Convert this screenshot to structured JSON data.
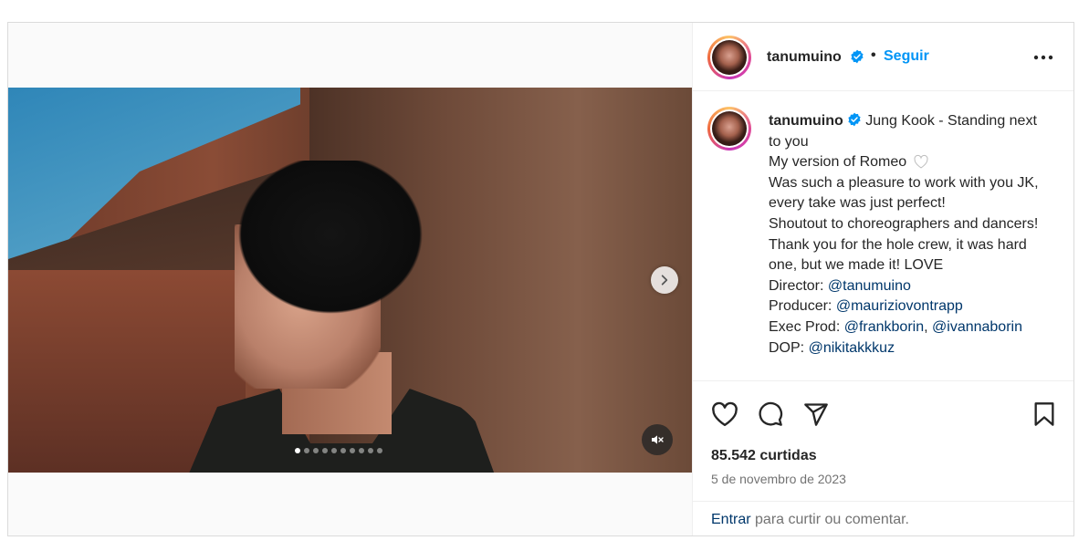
{
  "post": {
    "username": "tanumuino",
    "follow_label": "Seguir",
    "separator": "•",
    "carousel": {
      "slide_count": 10,
      "active_index": 0
    }
  },
  "caption": {
    "username": "tanumuino",
    "line1": "Jung Kook - Standing next to you",
    "line2": "My version of Romeo",
    "line3": "Was such a pleasure to work with you JK, every take was just perfect!",
    "line4": "Shoutout to choreographers and dancers!",
    "line5": "Thank you for the hole crew, it was hard one, but we made it! LOVE",
    "director_label": "Director:",
    "director": "@tanumuino",
    "producer_label": "Producer:",
    "producer": "@mauriziovontrapp",
    "exec_label": "Exec Prod:",
    "exec1": "@frankborin",
    "exec_sep": ",",
    "exec2": "@ivannaborin",
    "dop_label": "DOP:",
    "dop": "@nikitakkkuz"
  },
  "stats": {
    "likes": "85.542 curtidas",
    "date": "5 de novembro de 2023"
  },
  "comment_bar": {
    "login_link": "Entrar",
    "text": "para curtir ou comentar."
  },
  "colors": {
    "link": "#0095f6",
    "mention": "#00376b",
    "verified": "#0095f6"
  },
  "icons": [
    "verified-icon",
    "more-icon",
    "chevron-right-icon",
    "muted-audio-icon",
    "heart-icon",
    "comment-icon",
    "share-icon",
    "bookmark-icon"
  ]
}
